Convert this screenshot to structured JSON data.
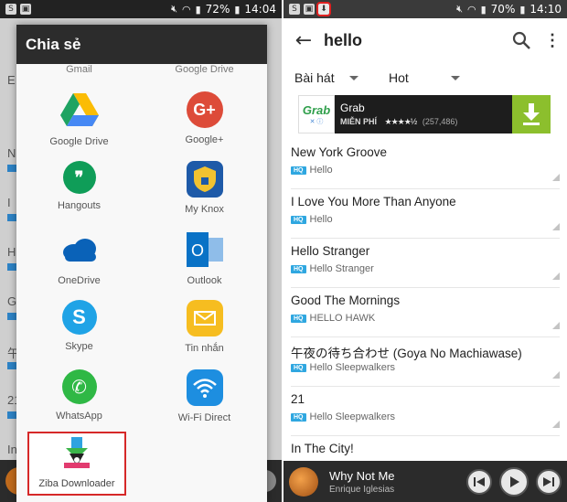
{
  "left": {
    "status": {
      "battery": "72%",
      "time": "14:04"
    },
    "share_sheet": {
      "title": "Chia sẻ",
      "cut_apps": [
        "Gmail",
        "Google Drive"
      ],
      "apps": [
        {
          "label": "Google Drive",
          "icon": "google-drive-icon"
        },
        {
          "label": "Google+",
          "icon": "google-plus-icon"
        },
        {
          "label": "Hangouts",
          "icon": "hangouts-icon"
        },
        {
          "label": "My Knox",
          "icon": "my-knox-icon"
        },
        {
          "label": "OneDrive",
          "icon": "onedrive-icon"
        },
        {
          "label": "Outlook",
          "icon": "outlook-icon"
        },
        {
          "label": "Skype",
          "icon": "skype-icon"
        },
        {
          "label": "Tin nhắn",
          "icon": "messages-icon"
        },
        {
          "label": "WhatsApp",
          "icon": "whatsapp-icon"
        },
        {
          "label": "Wi-Fi Direct",
          "icon": "wifi-direct-icon"
        }
      ],
      "highlighted_app": {
        "label": "Ziba Downloader",
        "icon": "ziba-downloader-icon",
        "highlight_color": "#d62828"
      }
    },
    "background_letters": [
      "E",
      "N",
      "I",
      "H",
      "G",
      "午",
      "21",
      "In"
    ]
  },
  "right": {
    "status": {
      "battery": "70%",
      "time": "14:10"
    },
    "search": {
      "query": "hello"
    },
    "filters": {
      "genre": "Bài hát",
      "sort": "Hot"
    },
    "ad": {
      "logo": "Grab",
      "name": "Grab",
      "free_label": "MIỄN PHÍ",
      "stars": "★★★★½",
      "reviews": "(257,486)",
      "download_color": "#8cbf2d"
    },
    "badge_label": "HQ",
    "songs": [
      {
        "title": "New York Groove",
        "album": "Hello"
      },
      {
        "title": "I Love You More Than Anyone",
        "album": "Hello"
      },
      {
        "title": "Hello Stranger",
        "album": "Hello Stranger"
      },
      {
        "title": "Good The Mornings",
        "album": "HELLO HAWK"
      },
      {
        "title": "午夜の待ち合わせ (Goya No Machiawase)",
        "album": "Hello Sleepwalkers"
      },
      {
        "title": "21",
        "album": "Hello Sleepwalkers"
      },
      {
        "title": "In The City!",
        "album": ""
      }
    ],
    "now_playing": {
      "title": "Why Not Me",
      "artist": "Enrique Iglesias"
    }
  }
}
